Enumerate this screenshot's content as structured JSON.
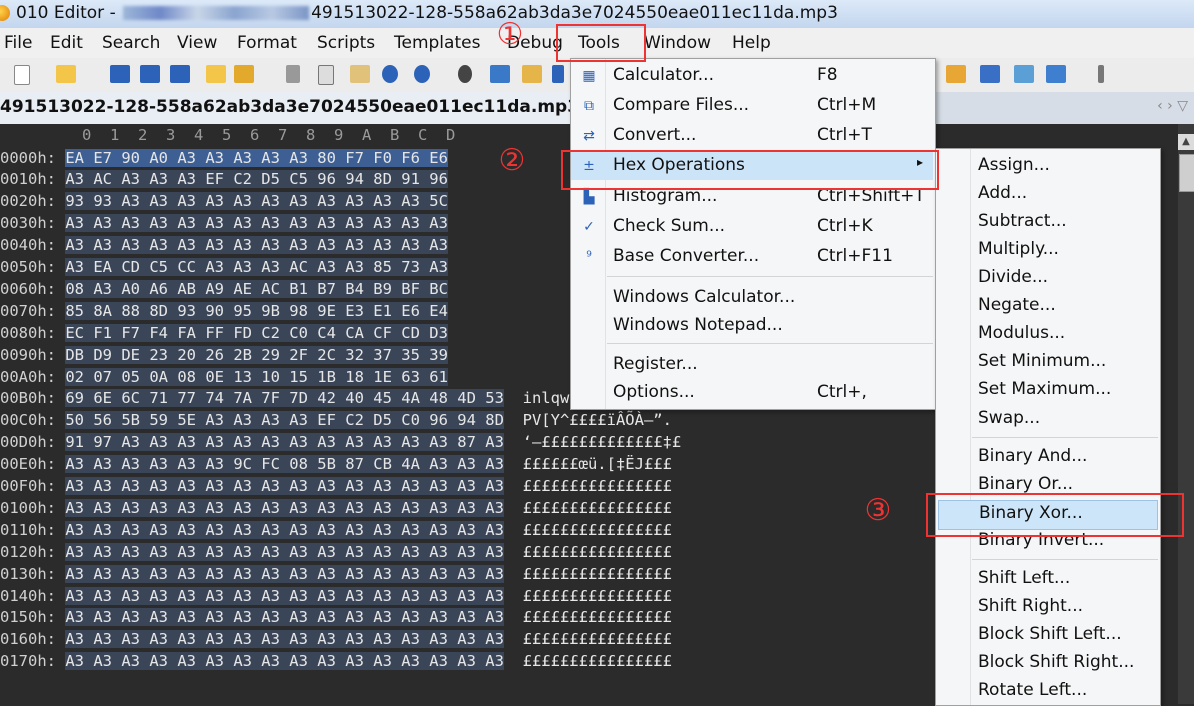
{
  "window": {
    "app_title": "010 Editor - ",
    "title_filename": "491513022-128-558a62ab3da3e7024550eae011ec11da.mp3"
  },
  "menubar": [
    "File",
    "Edit",
    "Search",
    "View",
    "Format",
    "Scripts",
    "Templates",
    "Debug",
    "Tools",
    "Window",
    "Help"
  ],
  "tab": {
    "label": "491513022-128-558a62ab3da3e7024550eae011ec11da.mp3",
    "close": "×",
    "nav": "‹  ›  ▽"
  },
  "hex": {
    "column_header": "0  1  2  3  4  5  6  7  8  9  A  B  C  D",
    "rows": [
      {
        "addr": "0000h:",
        "bytes": "EA E7 90 A0 A3 A3 A3 A3 A3 80 F7 F0 F6 E6",
        "ascii": ""
      },
      {
        "addr": "0010h:",
        "bytes": "A3 AC A3 A3 A3 EF C2 D5 C5 96 94 8D 91 96",
        "ascii": ""
      },
      {
        "addr": "0020h:",
        "bytes": "93 93 A3 A3 A3 A3 A3 A3 A3 A3 A3 A3 A3 5C",
        "ascii": ""
      },
      {
        "addr": "0030h:",
        "bytes": "A3 A3 A3 A3 A3 A3 A3 A3 A3 A3 A3 A3 A3 A3",
        "ascii": ""
      },
      {
        "addr": "0040h:",
        "bytes": "A3 A3 A3 A3 A3 A3 A3 A3 A3 A3 A3 A3 A3 A3",
        "ascii": ""
      },
      {
        "addr": "0050h:",
        "bytes": "A3 EA CD C5 CC A3 A3 A3 AC A3 A3 85 73 A3",
        "ascii": ""
      },
      {
        "addr": "0060h:",
        "bytes": "08 A3 A0 A6 AB A9 AE AC B1 B7 B4 B9 BF BC",
        "ascii": ""
      },
      {
        "addr": "0070h:",
        "bytes": "85 8A 88 8D 93 90 95 9B 98 9E E3 E1 E6 E4",
        "ascii": ""
      },
      {
        "addr": "0080h:",
        "bytes": "EC F1 F7 F4 FA FF FD C2 C0 C4 CA CF CD D3",
        "ascii": ""
      },
      {
        "addr": "0090h:",
        "bytes": "DB D9 DE 23 20 26 2B 29 2F 2C 32 37 35 39",
        "ascii": ""
      },
      {
        "addr": "00A0h:",
        "bytes": "02 07 05 0A 08 0E 13 10 15 1B 18 1E 63 61",
        "ascii": ""
      },
      {
        "addr": "00B0h:",
        "bytes": "69 6E 6C 71 77 74 7A 7F 7D 42 40 45 4A 48 4D 53",
        "ascii": "inlqwtz.}B@EJHMS"
      },
      {
        "addr": "00C0h:",
        "bytes": "50 56 5B 59 5E A3 A3 A3 A3 EF C2 D5 C0 96 94 8D",
        "ascii": "PV[Y^££££ïÂÕÀ–”."
      },
      {
        "addr": "00D0h:",
        "bytes": "91 97 A3 A3 A3 A3 A3 A3 A3 A3 A3 A3 A3 A3 87 A3",
        "ascii": "‘—£££££££££££££‡£"
      },
      {
        "addr": "00E0h:",
        "bytes": "A3 A3 A3 A3 A3 A3 9C FC 08 5B 87 CB 4A A3 A3 A3",
        "ascii": "££££££œü.[‡ËJ£££"
      },
      {
        "addr": "00F0h:",
        "bytes": "A3 A3 A3 A3 A3 A3 A3 A3 A3 A3 A3 A3 A3 A3 A3 A3",
        "ascii": "££££££££££££££££"
      },
      {
        "addr": "0100h:",
        "bytes": "A3 A3 A3 A3 A3 A3 A3 A3 A3 A3 A3 A3 A3 A3 A3 A3",
        "ascii": "££££££££££££££££"
      },
      {
        "addr": "0110h:",
        "bytes": "A3 A3 A3 A3 A3 A3 A3 A3 A3 A3 A3 A3 A3 A3 A3 A3",
        "ascii": "££££££££££££££££"
      },
      {
        "addr": "0120h:",
        "bytes": "A3 A3 A3 A3 A3 A3 A3 A3 A3 A3 A3 A3 A3 A3 A3 A3",
        "ascii": "££££££££££££££££"
      },
      {
        "addr": "0130h:",
        "bytes": "A3 A3 A3 A3 A3 A3 A3 A3 A3 A3 A3 A3 A3 A3 A3 A3",
        "ascii": "££££££££££££££££"
      },
      {
        "addr": "0140h:",
        "bytes": "A3 A3 A3 A3 A3 A3 A3 A3 A3 A3 A3 A3 A3 A3 A3 A3",
        "ascii": "££££££££££££££££"
      },
      {
        "addr": "0150h:",
        "bytes": "A3 A3 A3 A3 A3 A3 A3 A3 A3 A3 A3 A3 A3 A3 A3 A3",
        "ascii": "££££££££££££££££"
      },
      {
        "addr": "0160h:",
        "bytes": "A3 A3 A3 A3 A3 A3 A3 A3 A3 A3 A3 A3 A3 A3 A3 A3",
        "ascii": "££££££££££££££££"
      },
      {
        "addr": "0170h:",
        "bytes": "A3 A3 A3 A3 A3 A3 A3 A3 A3 A3 A3 A3 A3 A3 A3 A3",
        "ascii": "££££££££££££££££"
      }
    ]
  },
  "tools_menu": {
    "items": [
      {
        "name": "calculator",
        "icon": "calculator-icon",
        "glyph": "▦",
        "label": "Calculator...",
        "shortcut": "F8"
      },
      {
        "name": "compare-files",
        "icon": "compare-icon",
        "glyph": "⧉",
        "label": "Compare Files...",
        "shortcut": "Ctrl+M"
      },
      {
        "name": "convert",
        "icon": "convert-icon",
        "glyph": "⇄",
        "label": "Convert...",
        "shortcut": "Ctrl+T"
      },
      {
        "name": "hex-operations",
        "icon": "hex-ops-icon",
        "glyph": "±",
        "label": "Hex Operations",
        "shortcut": "",
        "submenu": "▸"
      },
      {
        "name": "histogram",
        "icon": "histogram-icon",
        "glyph": "▙",
        "label": "Histogram...",
        "shortcut": "Ctrl+Shift+T"
      },
      {
        "name": "check-sum",
        "icon": "checksum-icon",
        "glyph": "✓",
        "label": "Check Sum...",
        "shortcut": "Ctrl+K"
      },
      {
        "name": "base-converter",
        "icon": "base-converter-icon",
        "glyph": "⁹",
        "label": "Base Converter...",
        "shortcut": "Ctrl+F11"
      },
      {
        "name": "windows-calculator",
        "icon": "",
        "glyph": "",
        "label": "Windows Calculator...",
        "shortcut": ""
      },
      {
        "name": "windows-notepad",
        "icon": "",
        "glyph": "",
        "label": "Windows Notepad...",
        "shortcut": ""
      },
      {
        "name": "register",
        "icon": "",
        "glyph": "",
        "label": "Register...",
        "shortcut": ""
      },
      {
        "name": "options",
        "icon": "",
        "glyph": "",
        "label": "Options...",
        "shortcut": "Ctrl+,"
      }
    ]
  },
  "hex_ops_submenu": {
    "items": [
      "Assign...",
      "Add...",
      "Subtract...",
      "Multiply...",
      "Divide...",
      "Negate...",
      "Modulus...",
      "Set Minimum...",
      "Set Maximum...",
      "Swap...",
      "Binary And...",
      "Binary Or...",
      "Binary Xor...",
      "Binary Invert...",
      "Shift Left...",
      "Shift Right...",
      "Block Shift Left...",
      "Block Shift Right...",
      "Rotate Left..."
    ]
  },
  "annotations": {
    "step1": "①",
    "step2": "②",
    "step3": "③"
  },
  "colors": {
    "callout": "#ee3333",
    "menu_highlight": "#cce4f7",
    "hex_bg": "#2b2b2b",
    "selection": "#3d5f93"
  }
}
